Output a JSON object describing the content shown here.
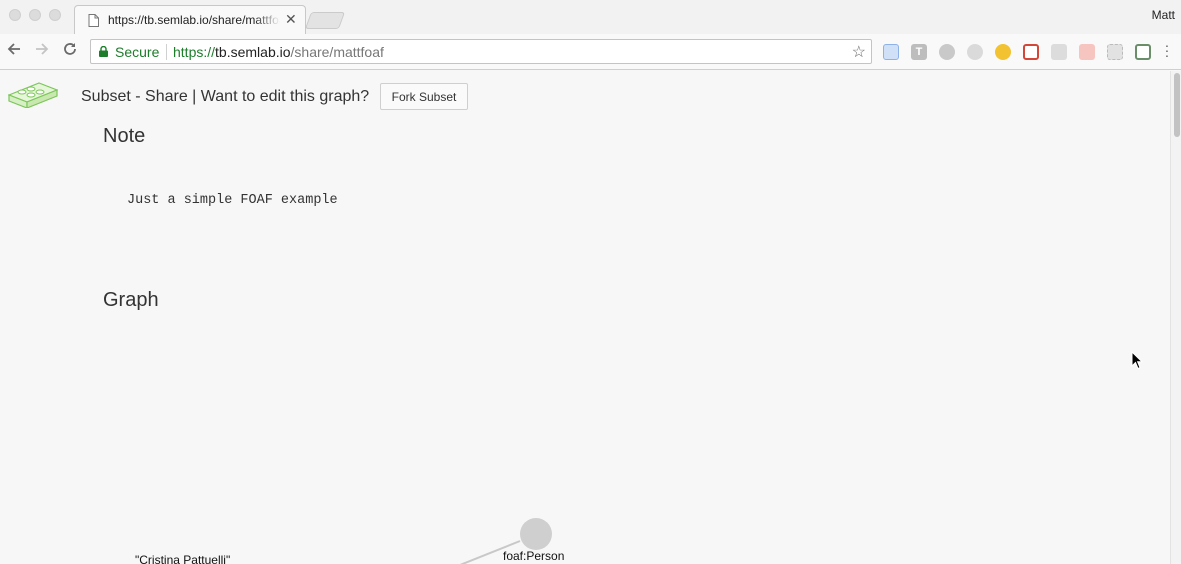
{
  "browser": {
    "tab_title": "https://tb.semlab.io/share/mattfoaf",
    "profile_name": "Matt",
    "security_label": "Secure",
    "url_scheme": "https://",
    "url_host": "tb.semlab.io",
    "url_path": "/share/mattfoaf",
    "colors": {
      "secure_green": "#1c7d2a"
    }
  },
  "header": {
    "title": "Subset - Share | Want to edit this graph?",
    "fork_button": "Fork Subset"
  },
  "note": {
    "heading": "Note",
    "text": "Just a simple FOAF example"
  },
  "graph": {
    "heading": "Graph",
    "nodes": [
      {
        "label": "foaf:Person",
        "type": "class"
      },
      {
        "label": "\"Cristina Pattuelli\"",
        "type": "literal"
      }
    ]
  }
}
